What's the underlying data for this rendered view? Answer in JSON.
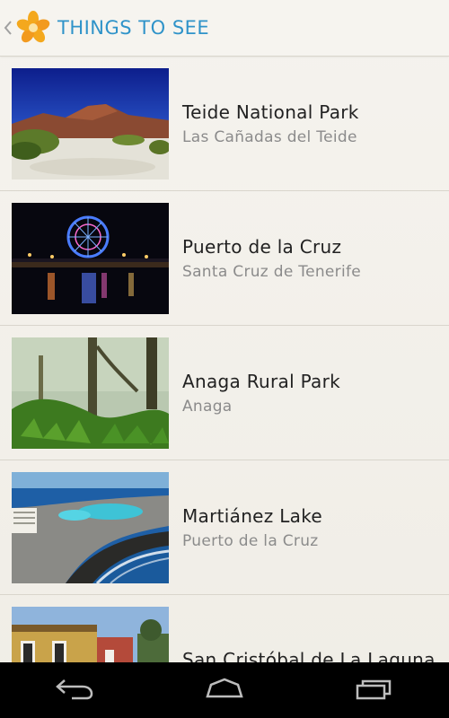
{
  "action_bar": {
    "title": "THINGS TO SEE",
    "up_icon": "chevron-left-icon",
    "logo_icon": "flower-logo-icon"
  },
  "items": [
    {
      "title": "Teide National Park",
      "subtitle": "Las Cañadas del Teide"
    },
    {
      "title": "Puerto de la Cruz",
      "subtitle": "Santa Cruz de Tenerife"
    },
    {
      "title": "Anaga Rural Park",
      "subtitle": "Anaga"
    },
    {
      "title": "Martiánez Lake",
      "subtitle": "Puerto de la Cruz"
    },
    {
      "title": "San Cristóbal de La Laguna",
      "subtitle": ""
    }
  ],
  "nav_bar": {
    "back_icon": "back-arrow-icon",
    "home_icon": "home-icon",
    "recents_icon": "recent-apps-icon"
  },
  "colors": {
    "title_blue": "#2f93c9",
    "logo_orange": "#f29a1f",
    "background": "#f3f0ea",
    "nav_black": "#000000"
  }
}
